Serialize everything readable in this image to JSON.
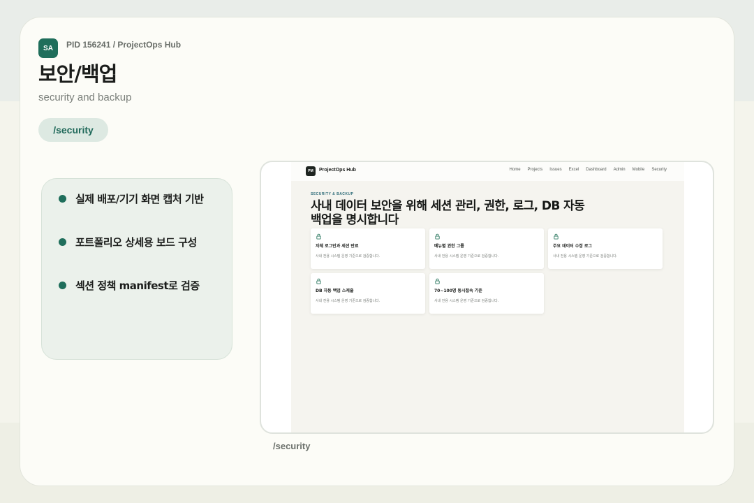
{
  "avatar_initials": "SA",
  "pid_line": "PID 156241 / ProjectOps Hub",
  "page_title": "보안/백업",
  "page_subtitle": "security and backup",
  "route_pill": "/security",
  "features": [
    "실제 배포/기기 화면 캡처 기반",
    "포트폴리오 상세용 보드 구성",
    "섹션 정책 manifest로 검증"
  ],
  "screenshot": {
    "logo_initials": "PM",
    "app_name": "ProjectOps Hub",
    "nav": [
      "Home",
      "Projects",
      "Issues",
      "Excel",
      "Dashboard",
      "Admin",
      "Mobile",
      "Security"
    ],
    "eyebrow": "SECURITY & BACKUP",
    "hero_line1": "사내 데이터 보안을 위해 세션 관리, 권한, 로그, DB 자동",
    "hero_line2": "백업을 명시합니다",
    "cards": [
      {
        "title": "자체 로그인과 세션 만료",
        "desc": "사내 전용 시스템 운영 기준으로 검증합니다."
      },
      {
        "title": "메뉴별 권한 그룹",
        "desc": "사내 전용 시스템 운영 기준으로 검증합니다."
      },
      {
        "title": "주요 데이터 수정 로그",
        "desc": "사내 전용 시스템 운영 기준으로 검증합니다."
      },
      {
        "title": "DB 자동 백업 스케줄",
        "desc": "사내 전용 시스템 운영 기준으로 검증합니다."
      },
      {
        "title": "70~100명 동시접속 기준",
        "desc": "사내 전용 시스템 운영 기준으로 검증합니다."
      }
    ]
  },
  "caption": "/security",
  "colors": {
    "accent": "#1f6e5b",
    "pill_bg": "#dde9e2",
    "eyebrow": "#2d6b78"
  },
  "icons": [
    "lock-icon"
  ]
}
